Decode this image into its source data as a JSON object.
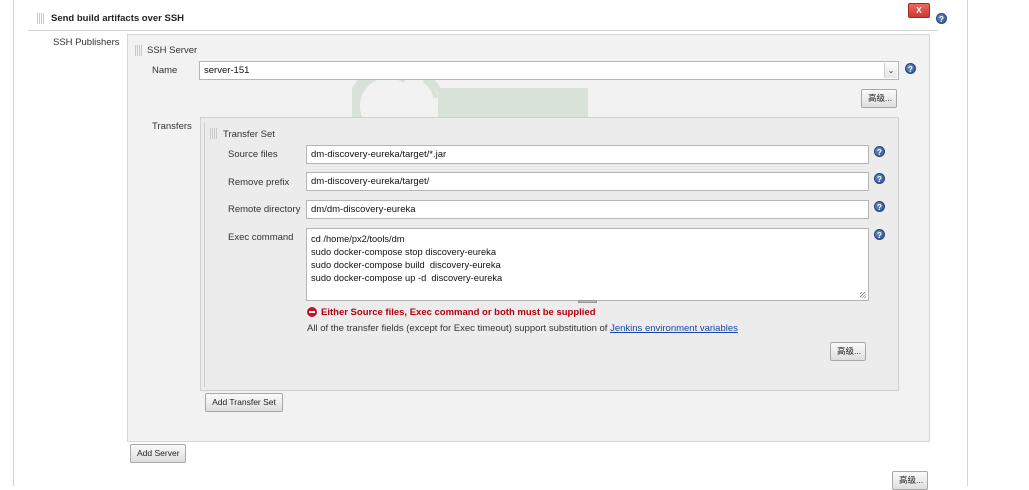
{
  "section": {
    "title": "Send build artifacts over SSH",
    "delete_label": "X"
  },
  "publishers": {
    "label": "SSH Publishers",
    "server_header": "SSH Server",
    "name_label": "Name",
    "name_value": "server-151",
    "advanced_label": "高级...",
    "transfers_label": "Transfers",
    "add_server_label": "Add Server",
    "bottom_advanced_label": "高级..."
  },
  "transfer_set": {
    "header": "Transfer Set",
    "source_files_label": "Source files",
    "source_files_value": "dm-discovery-eureka/target/*.jar",
    "remove_prefix_label": "Remove prefix",
    "remove_prefix_value": "dm-discovery-eureka/target/",
    "remote_directory_label": "Remote directory",
    "remote_directory_value": "dm/dm-discovery-eureka",
    "exec_command_label": "Exec command",
    "exec_command_lines": [
      "cd /home/px2/tools/dm",
      "sudo docker-compose stop discovery-eureka",
      "sudo docker-compose build  discovery-eureka",
      "sudo docker-compose up -d  discovery-eureka"
    ],
    "error_text": "Either Source files, Exec command or both must be supplied",
    "info_text": "All of the transfer fields (except for Exec timeout) support substitution of",
    "info_link": "Jenkins environment variables",
    "advanced_label": "高级...",
    "add_transfer_label": "Add Transfer Set"
  },
  "colors": {
    "delete_button": "#d9453b",
    "error": "#b3000f",
    "link": "#1a45a6",
    "help": "#2c4f8e"
  }
}
